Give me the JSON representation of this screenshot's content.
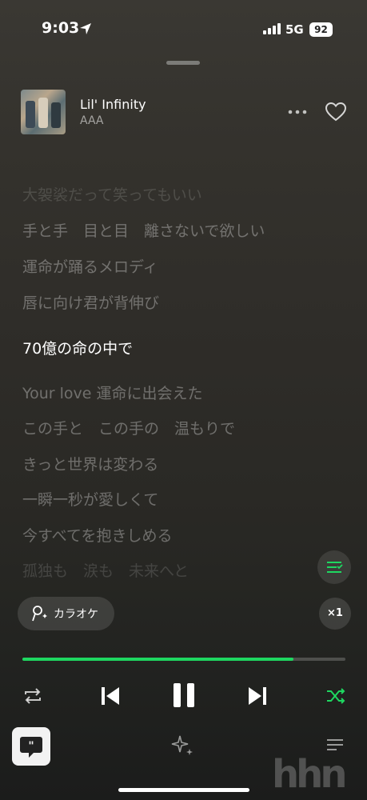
{
  "status_bar": {
    "time": "9:03",
    "network": "5G",
    "battery": "92"
  },
  "track": {
    "title": "Lil' Infinity",
    "artist": "AAA"
  },
  "lyrics": [
    "大袈裟だって笑ってもいい",
    "手と手　目と目　離さないで欲しい",
    "運命が踊るメロディ",
    "唇に向け君が背伸び",
    "70億の命の中で",
    "Your love 運命に出会えた",
    "この手と　この手の　温もりで",
    "きっと世界は変わる",
    "一瞬一秒が愛しくて",
    "今すべてを抱きしめる",
    "孤独も　涙も　未来へと"
  ],
  "active_lyric_index": 4,
  "karaoke": {
    "label": "カラオケ"
  },
  "speed": {
    "label": "×1"
  },
  "playback": {
    "progress": 0.84,
    "state": "playing",
    "shuffle": true
  },
  "colors": {
    "accent": "#1ed760"
  },
  "watermark": "hhn",
  "icons": [
    "location-arrow-icon",
    "signal-icon",
    "more-icon",
    "heart-icon",
    "queue-icon",
    "microphone-icon",
    "repeat-icon",
    "previous-icon",
    "pause-icon",
    "next-icon",
    "shuffle-icon",
    "lyrics-icon",
    "sparkle-icon",
    "list-icon"
  ]
}
